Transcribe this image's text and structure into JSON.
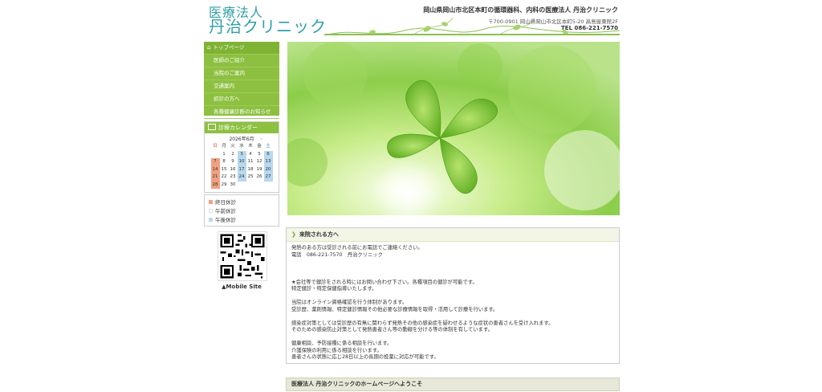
{
  "header": {
    "logo_line1": "医療法人",
    "logo_line2": "丹治クリニック",
    "title": "岡山県岡山市北区本町の循環器科、内科の医療法人 丹治クリニック",
    "address": "〒700-0901 岡山県岡山市北区本町5-20 高島屋東館2F",
    "tel": "TEL 086-221-7570"
  },
  "menu": {
    "items": [
      {
        "label": "トップページ"
      },
      {
        "label": "医師のご紹介"
      },
      {
        "label": "当院のご案内"
      },
      {
        "label": "交通案内"
      },
      {
        "label": "初診の方へ"
      },
      {
        "label": "各種健康診断のお知らせ"
      }
    ]
  },
  "calendar": {
    "heading": "診療カレンダー",
    "month": "2026年6月",
    "next": "›",
    "weekdays": [
      "日",
      "月",
      "火",
      "水",
      "木",
      "金",
      "土"
    ],
    "weeks": [
      [
        "",
        "1",
        "2",
        "3",
        "4",
        "5",
        "6"
      ],
      [
        "7",
        "8",
        "9",
        "10",
        "11",
        "12",
        "13"
      ],
      [
        "14",
        "15",
        "16",
        "17",
        "18",
        "19",
        "20"
      ],
      [
        "21",
        "22",
        "23",
        "24",
        "25",
        "26",
        "27"
      ],
      [
        "28",
        "29",
        "30",
        "",
        "",
        "",
        ""
      ]
    ],
    "status": [
      [
        "",
        "",
        "",
        "pm",
        "",
        "",
        "pm"
      ],
      [
        "full",
        "",
        "",
        "pm",
        "",
        "",
        "pm"
      ],
      [
        "full",
        "",
        "",
        "pm",
        "",
        "",
        "pm"
      ],
      [
        "full",
        "",
        "",
        "pm",
        "",
        "",
        "pm"
      ],
      [
        "full",
        "",
        "",
        "",
        "",
        "",
        ""
      ]
    ]
  },
  "legend": {
    "items": [
      {
        "label": "終日休診",
        "color": "#f0a080"
      },
      {
        "label": "午前休診",
        "color": "#ffffff"
      },
      {
        "label": "午後休診",
        "color": "#b8d8ee"
      }
    ]
  },
  "mobile": {
    "label": "▲Mobile Site"
  },
  "notice": {
    "heading": "来院される方へ",
    "lines": [
      "発熱のある方は受診される前にお電話でご連絡ください。",
      "電話　086-221-7570　丹治クリニック",
      "",
      "",
      "",
      "★会社等で健診をされる時にはお問い合わせ下さい。各種項目の健診が可能です。",
      "特定健診・特定保健指導いたします。",
      "",
      "当院はオンライン資格確認を行う体制があります。",
      "受診歴、薬剤情報、特定健診情報その他必要な診療情報を取得・活用して診療を行います。",
      "",
      "感染症対策としては受診歴の有無に関わらず発熱その他の感染症を疑わせるような症状の患者さんを受け入れます。",
      "そのための感染防止対策として発熱患者さん等の動線を分ける等の体制を有しています。",
      "",
      "健康相談、予防接種に係る相談を行います。",
      "介護保険の利用に係る相談を行います。",
      "患者さんの状態に応じ28日以上の長期の投薬に対応が可能です。"
    ]
  },
  "welcome": {
    "heading": "医療法人 丹治クリニックのホームページへようこそ"
  },
  "colors": {
    "brand": "#2fa0a8",
    "menu": "#8dc040"
  }
}
